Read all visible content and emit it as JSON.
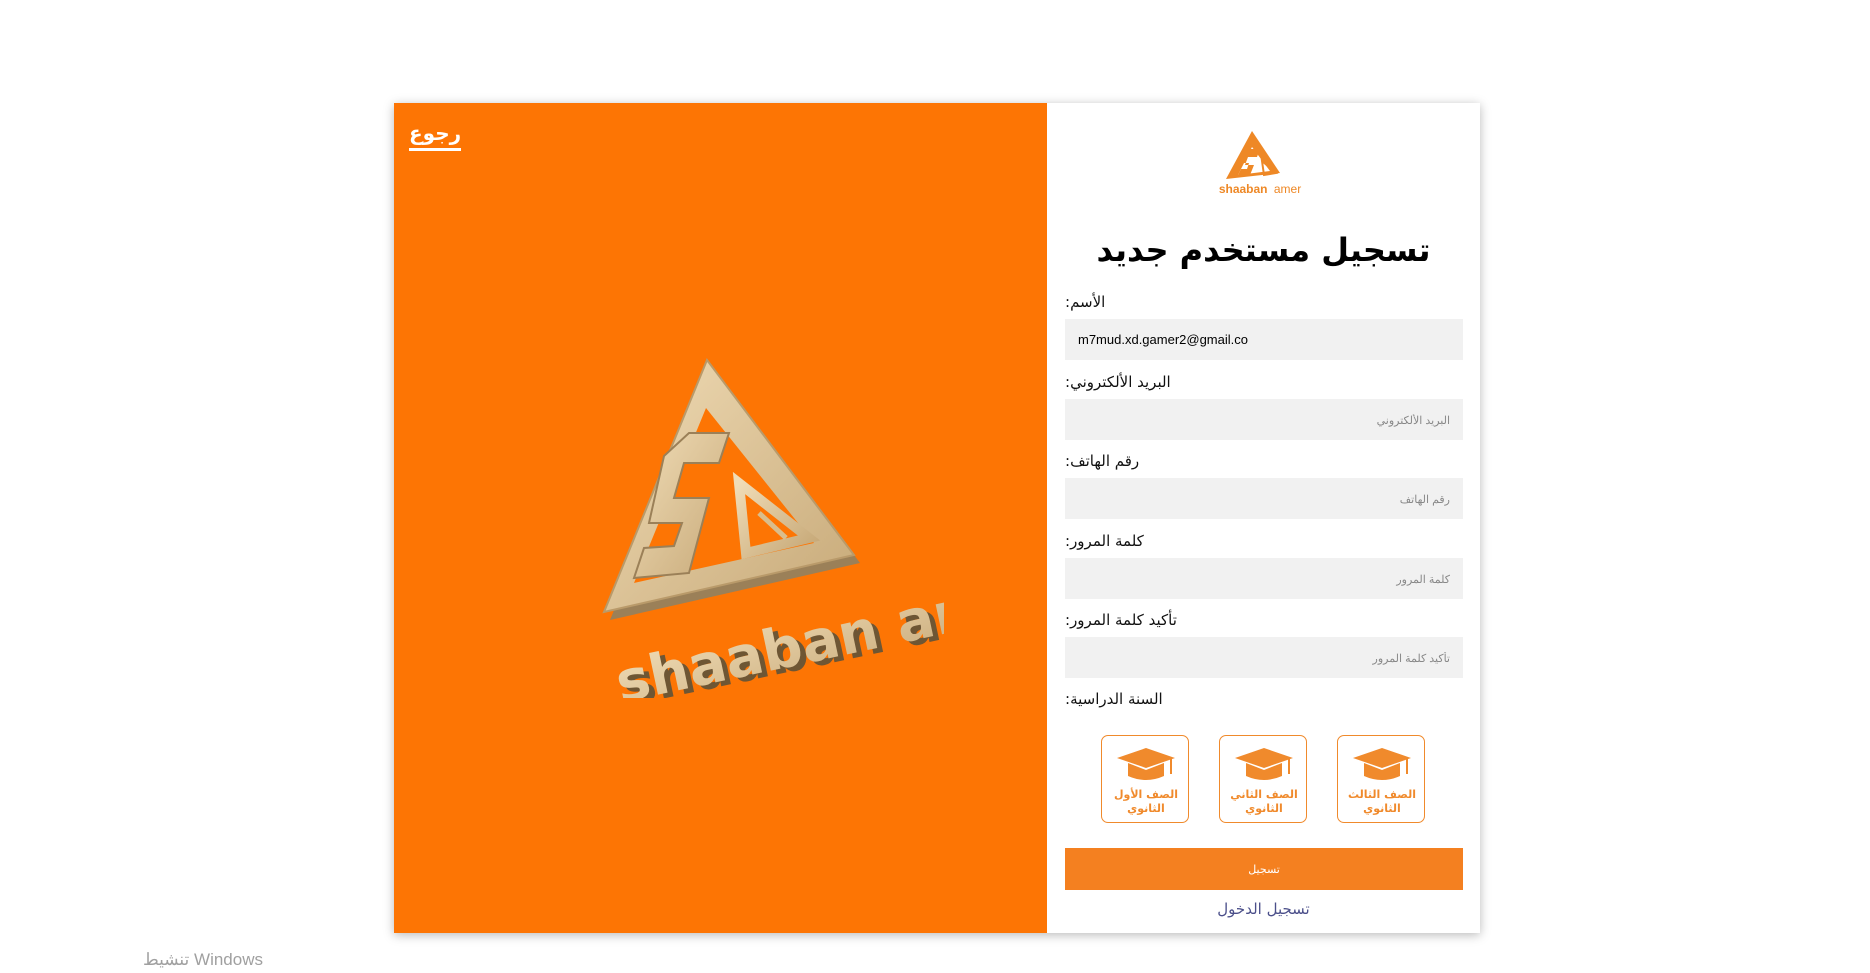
{
  "nav": {
    "back_label": "رجوع"
  },
  "brand": {
    "logo_text": "shaaban amer",
    "logo_text_first": "shaaban",
    "logo_text_second": "amer"
  },
  "form": {
    "title": "تسجيل مستخدم جديد",
    "fields": [
      {
        "label": ":الأسم",
        "value": "m7mud.xd.gamer2@gmail.co",
        "placeholder": ""
      },
      {
        "label": ":البريد الألكتروني",
        "value": "",
        "placeholder": "البريد الألكتروني"
      },
      {
        "label": ":رقم الهاتف",
        "value": "",
        "placeholder": "رقم الهاتف"
      },
      {
        "label": ":كلمة المرور",
        "value": "",
        "placeholder": "كلمة المرور"
      },
      {
        "label": ":تأكيد كلمة المرور",
        "value": "",
        "placeholder": "تأكيد كلمة المرور"
      }
    ],
    "year_label": ":السنة الدراسية",
    "grades": [
      {
        "line1": "الصف الأول",
        "line2": "الثانوي",
        "icon": "graduation-cap-icon"
      },
      {
        "line1": "الصف الثاني",
        "line2": "الثانوي",
        "icon": "graduation-cap-icon"
      },
      {
        "line1": "الصف الثالث",
        "line2": "الثانوي",
        "icon": "graduation-cap-icon"
      }
    ],
    "submit_label": "تسجيل",
    "login_link": "تسجيل الدخول"
  },
  "os": {
    "watermark": "تنشيط Windows"
  },
  "colors": {
    "panel": "#fd7504",
    "accent": "#f48020",
    "link": "#4b4f8a",
    "input_bg": "#f1f1f1",
    "logo_gold": "#d9bd8c"
  }
}
